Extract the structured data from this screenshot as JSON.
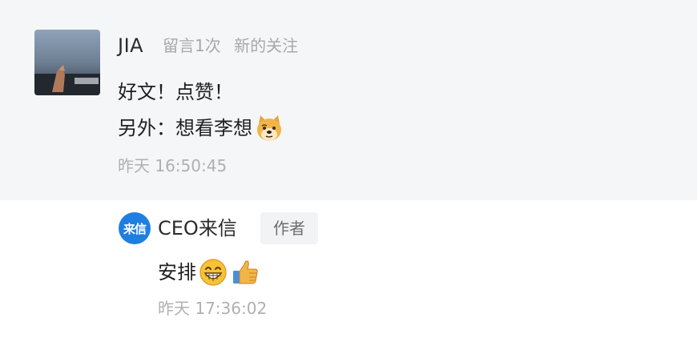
{
  "comment": {
    "username": "JIA",
    "tags": [
      "留言1次",
      "新的关注"
    ],
    "lines": [
      "好文！点赞！",
      "另外：想看李想"
    ],
    "emoji_after_line2": "doge-icon",
    "timestamp": "昨天 16:50:45"
  },
  "reply": {
    "avatar_text": "来信",
    "name": "CEO来信",
    "badge": "作者",
    "text": "安排",
    "emojis": [
      "grin-icon",
      "thumbs-up-icon"
    ],
    "timestamp": "昨天 17:36:02"
  },
  "colors": {
    "comment_background": "#f5f6f8",
    "reply_avatar": "#1f7fe0",
    "meta_text": "#a8a8a8"
  }
}
